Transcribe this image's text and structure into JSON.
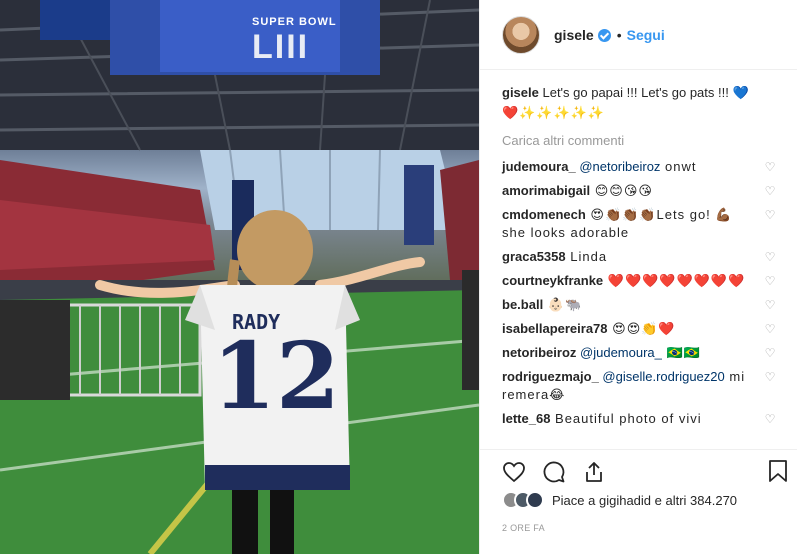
{
  "post": {
    "author": "gisele",
    "dot": "•",
    "follow_label": "Segui",
    "caption_author": "gisele",
    "caption_text": "Let's go papai !!! Let's go pats !!! 💙",
    "caption_emojis": "❤️✨✨✨✨✨",
    "load_more": "Carica altri commenti"
  },
  "photo": {
    "scoreboard_title": "SUPER BOWL",
    "scoreboard_number": "LIII",
    "jersey_name": "RADY",
    "jersey_number": "12"
  },
  "comments": [
    {
      "user": "judemoura_",
      "mention": "@netoribeiroz",
      "text": " onwt"
    },
    {
      "user": "amorimabigail",
      "mention": "",
      "text": " 😊😊😘😘"
    },
    {
      "user": "cmdomenech",
      "mention": "",
      "text": " 😍👏🏾👏🏾👏🏾Lets go! 💪🏾she looks adorable"
    },
    {
      "user": "graca5358",
      "mention": "",
      "text": " Linda"
    },
    {
      "user": "courtneykfranke",
      "mention": "",
      "text": " ❤️❤️❤️❤️❤️❤️❤️❤️"
    },
    {
      "user": "be.ball",
      "mention": "",
      "text": " 👶🏻🐃"
    },
    {
      "user": "isabellapereira78",
      "mention": "",
      "text": " 😍😍👏❤️"
    },
    {
      "user": "netoribeiroz",
      "mention": "@judemoura_",
      "text": " 🇧🇷🇧🇷"
    },
    {
      "user": "rodriguezmajo_",
      "mention": "@giselle.rodriguez20",
      "text": " mi remera😂"
    },
    {
      "user": "lette_68",
      "mention": "",
      "text": " Beautiful photo of vivi"
    }
  ],
  "likes": {
    "text_prefix": "Piace a ",
    "first_user": "gigihadid",
    "text_middle": " e altri ",
    "count": "384.270"
  },
  "timestamp": "2 ORE FA",
  "icons": {
    "like": "heart-icon",
    "comment": "comment-icon",
    "share": "share-icon",
    "save": "bookmark-icon",
    "verified": "verified-badge-icon",
    "comment_like": "heart-outline-icon"
  },
  "colors": {
    "link": "#3897f0",
    "mention": "#003569",
    "muted": "#999999",
    "text": "#262626"
  }
}
